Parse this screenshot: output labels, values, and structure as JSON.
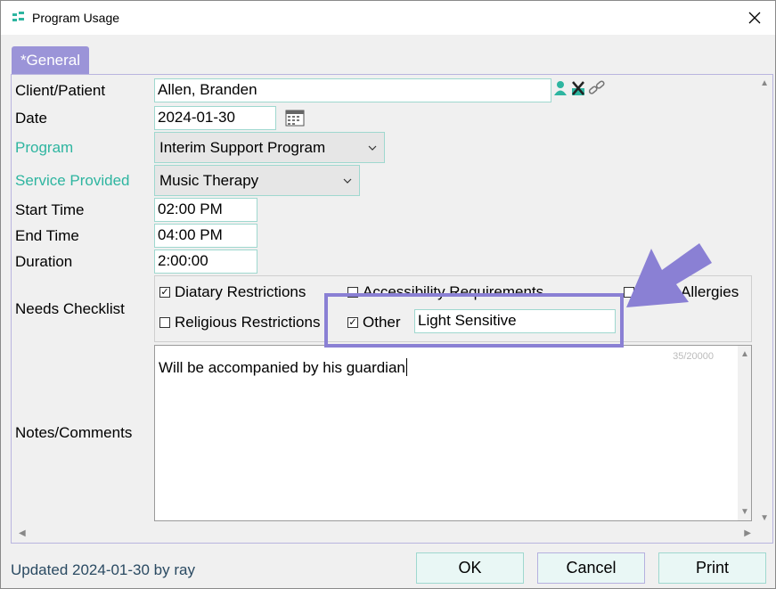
{
  "window": {
    "title": "Program Usage"
  },
  "tab": {
    "label": "*General"
  },
  "form": {
    "client_label": "Client/Patient",
    "client_value": "Allen, Branden",
    "date_label": "Date",
    "date_value": "2024-01-30",
    "program_label": "Program",
    "program_value": "Interim Support Program",
    "service_label": "Service Provided",
    "service_value": "Music Therapy",
    "start_label": "Start Time",
    "start_value": "02:00 PM",
    "end_label": "End Time",
    "end_value": "04:00 PM",
    "duration_label": "Duration",
    "duration_value": "2:00:00",
    "needs_label": "Needs Checklist",
    "notes_label": "Notes/Comments"
  },
  "checklist": {
    "items": [
      {
        "label": "Diatary Restrictions",
        "checked": true
      },
      {
        "label": "Accessibility Requirements",
        "checked": false
      },
      {
        "label": "Allergies",
        "checked": false
      },
      {
        "label": "Religious Restrictions",
        "checked": false
      },
      {
        "label": "Other",
        "checked": true
      }
    ],
    "other_value": "Light Sensitive"
  },
  "notes": {
    "text": "Will be accompanied by his guardian",
    "counter": "35/20000"
  },
  "footer": {
    "updated_text": "Updated 2024-01-30 by ray",
    "ok_label": "OK",
    "cancel_label": "Cancel",
    "print_label": "Print"
  },
  "colors": {
    "accent": "#9b94d8",
    "teal": "#2eb5a0",
    "annotation": "#8a80d4"
  },
  "icons": [
    "app-icon",
    "close-icon",
    "person-icon",
    "clear-x-icon",
    "link-icon",
    "calendar-icon",
    "chevron-down-icon",
    "check-icon",
    "arrow-annotation"
  ]
}
